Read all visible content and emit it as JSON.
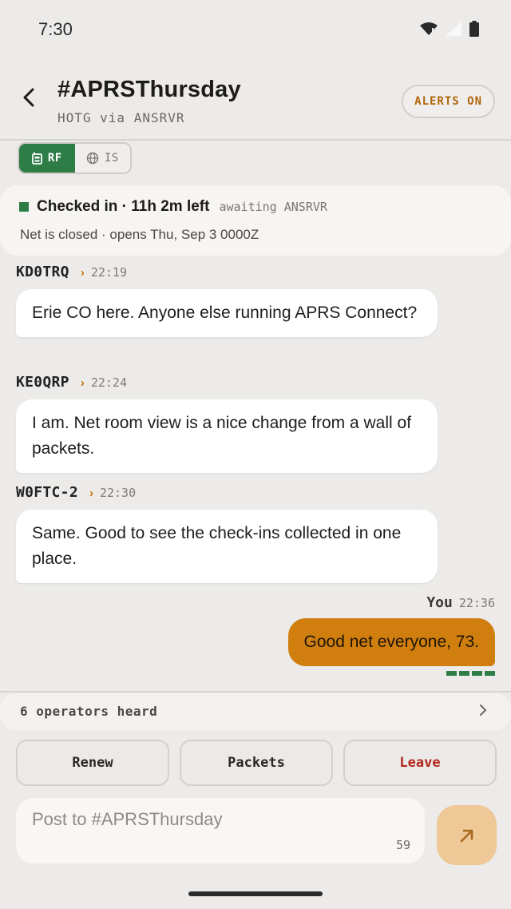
{
  "status": {
    "time": "7:30"
  },
  "header": {
    "title": "#APRSThursday",
    "subtitle": "HOTG via ANSRVR",
    "alerts_label": "ALERTS ON"
  },
  "source_toggle": [
    {
      "label": "RF",
      "icon": "radio-icon",
      "active": true
    },
    {
      "label": "IS",
      "icon": "globe-icon",
      "active": false
    }
  ],
  "checkin": {
    "status": "Checked in · 11h 2m left",
    "awaiting": "awaiting ANSRVR",
    "net_status": "Net is closed · opens Thu, Sep 3 0000Z"
  },
  "messages": [
    {
      "callsign": "KD0TRQ",
      "time": "22:19",
      "text": "Erie CO here. Anyone else running APRS Connect?"
    },
    {
      "callsign": "KE0QRP",
      "time": "22:24",
      "text": "I am. Net room view is a nice change from a wall of packets."
    },
    {
      "callsign": "W0FTC-2",
      "time": "22:30",
      "text": "Same. Good to see the check-ins collected in one place."
    }
  ],
  "outgoing": {
    "label": "You",
    "time": "22:36",
    "text": "Good net everyone, 73."
  },
  "operators": {
    "label": "6 operators heard"
  },
  "actions": {
    "renew": "Renew",
    "packets": "Packets",
    "leave": "Leave"
  },
  "composer": {
    "placeholder": "Post to #APRSThursday",
    "value": "",
    "char_count": "59"
  },
  "colors": {
    "accent": "#d07f0e",
    "rf_active": "#2e7d47",
    "leave": "#b3261e",
    "alerts": "#b0670b"
  }
}
